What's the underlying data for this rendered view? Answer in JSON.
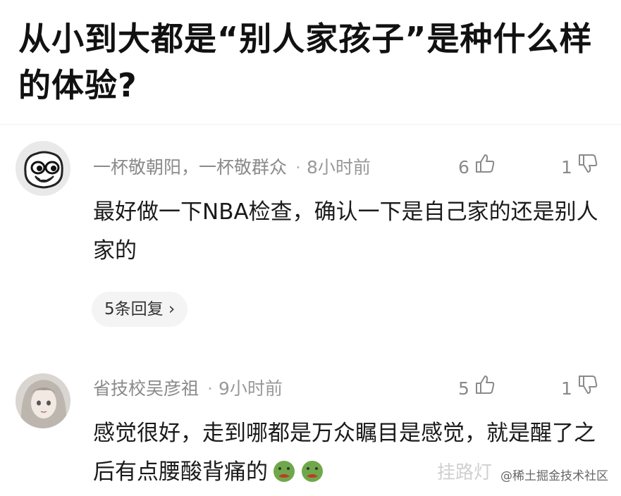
{
  "question": {
    "title": "从小到大都是“别人家孩子”是种什么样的体验?"
  },
  "comments": [
    {
      "username": "一杯敬朝阳，一杯敬群众",
      "separator": "·",
      "time": "8小时前",
      "likes": "6",
      "reply_count": "1",
      "text": "最好做一下NBA检查，确认一下是自己家的还是别人家的",
      "replies_label": "5条回复 ›",
      "avatar_icon": "cartoon-face-avatar"
    },
    {
      "username": "省技校吴彦祖",
      "separator": "·",
      "time": "9小时前",
      "likes": "5",
      "reply_count": "1",
      "text": "感觉很好，走到哪都是万众瞩目是感觉，就是醒了之后有点腰酸背痛的",
      "emoji": [
        "nauseated-face-emoji",
        "nauseated-face-emoji"
      ],
      "avatar_icon": "anime-girl-avatar"
    }
  ],
  "watermark": {
    "text_faded": "挂路灯",
    "text": "@稀土掘金技术社区"
  },
  "colors": {
    "background": "#ffffff",
    "title": "#111111",
    "meta": "#8a8a8a",
    "body": "#1a1a1a",
    "reply_button_bg": "#f4f4f4",
    "emoji_green": "#6fa84a"
  }
}
